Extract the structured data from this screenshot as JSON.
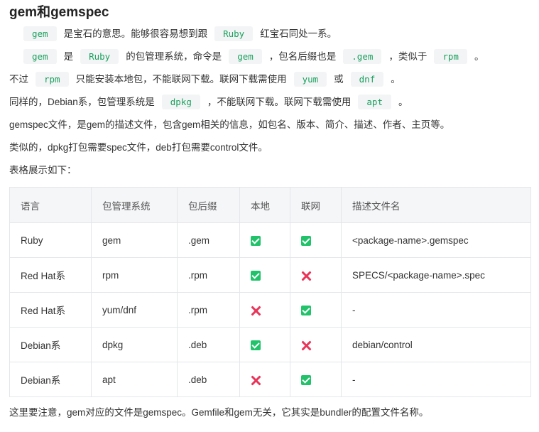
{
  "title": "gem和gemspec",
  "line1": {
    "code_a": "gem",
    "t1": "是宝石的意思。能够很容易想到跟",
    "code_b": "Ruby",
    "t2": "红宝石同处一系。"
  },
  "line2": {
    "code_a": "gem",
    "t1": "是",
    "code_b": "Ruby",
    "t2": "的包管理系统，命令是",
    "code_c": "gem",
    "t3": "，包名后缀也是",
    "code_d": ".gem",
    "t4": "，类似于",
    "code_e": "rpm",
    "t5": "。"
  },
  "line3": {
    "t0": "不过",
    "code_a": "rpm",
    "t1": "只能安装本地包，不能联网下载。联网下载需使用",
    "code_b": "yum",
    "t2": "或",
    "code_c": "dnf",
    "t3": "。"
  },
  "line4": {
    "t0": "同样的，Debian系，包管理系统是",
    "code_a": "dpkg",
    "t1": "，不能联网下载。联网下载需使用",
    "code_b": "apt",
    "t2": "。"
  },
  "line5": "gemspec文件，是gem的描述文件，包含gem相关的信息，如包名、版本、简介、描述、作者、主页等。",
  "line6": "类似的，dpkg打包需要spec文件，deb打包需要control文件。",
  "line7": "表格展示如下：",
  "table": {
    "headers": [
      "语言",
      "包管理系统",
      "包后缀",
      "本地",
      "联网",
      "描述文件名"
    ],
    "rows": [
      {
        "lang": "Ruby",
        "pm": "gem",
        "ext": ".gem",
        "local": "check",
        "net": "check",
        "desc": "<package-name>.gemspec"
      },
      {
        "lang": "Red Hat系",
        "pm": "rpm",
        "ext": ".rpm",
        "local": "check",
        "net": "cross",
        "desc": "SPECS/<package-name>.spec"
      },
      {
        "lang": "Red Hat系",
        "pm": "yum/dnf",
        "ext": ".rpm",
        "local": "cross",
        "net": "check",
        "desc": "-"
      },
      {
        "lang": "Debian系",
        "pm": "dpkg",
        "ext": ".deb",
        "local": "check",
        "net": "cross",
        "desc": "debian/control"
      },
      {
        "lang": "Debian系",
        "pm": "apt",
        "ext": ".deb",
        "local": "cross",
        "net": "check",
        "desc": "-"
      }
    ]
  },
  "footer": "这里要注意，gem对应的文件是gemspec。Gemfile和gem无关，它其实是bundler的配置文件名称。",
  "colors": {
    "check": "#21c36a",
    "cross": "#e8355a",
    "code": "#1aa15f"
  }
}
